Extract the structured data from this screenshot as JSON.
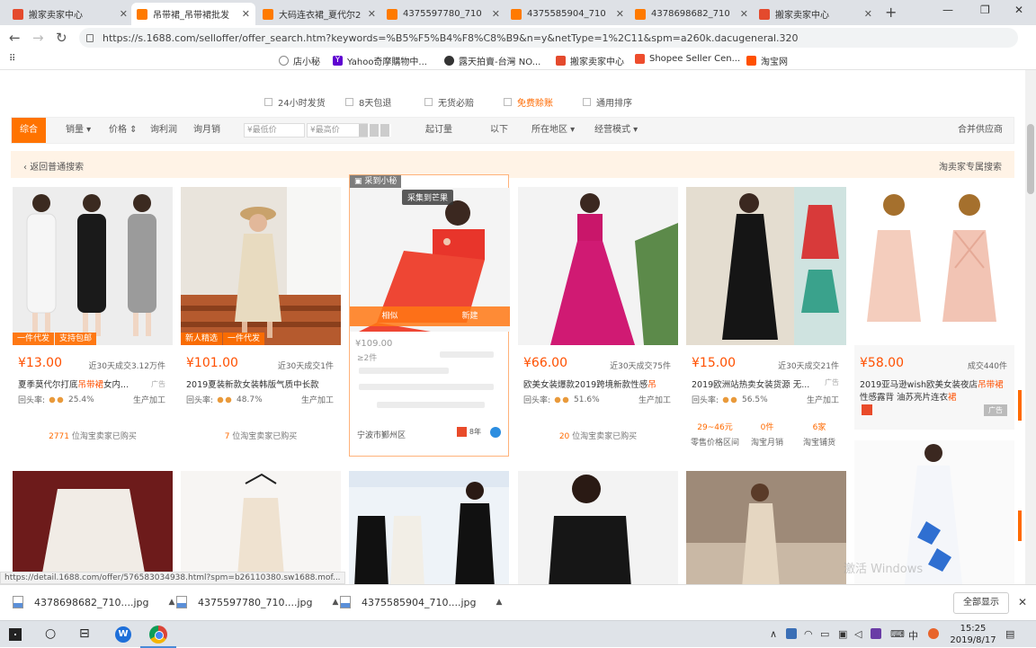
{
  "browser": {
    "tabs": [
      {
        "label": "搬家卖家中心",
        "icon": "red"
      },
      {
        "label": "吊带裙_吊带裙批发",
        "icon": "orange",
        "active": true
      },
      {
        "label": "大码连衣裙_夏代尔2",
        "icon": "orange"
      },
      {
        "label": "4375597780_710",
        "icon": "orange"
      },
      {
        "label": "4375585904_710",
        "icon": "orange"
      },
      {
        "label": "4378698682_710",
        "icon": "orange"
      },
      {
        "label": "搬家卖家中心",
        "icon": "red"
      }
    ],
    "url": "https://s.1688.com/selloffer/offer_search.htm?keywords=%B5%F5%B4%F8%C8%B9&n=y&netType=1%2C11&spm=a260k.dacugeneral.320",
    "bookmarks": [
      {
        "label": "店小秘"
      },
      {
        "label": "Yahoo奇摩購物中..."
      },
      {
        "label": "露天拍賣-台灣 NO..."
      },
      {
        "label": "搬家卖家中心"
      },
      {
        "label": "Shopee Seller Cen..."
      },
      {
        "label": "淘宝网"
      }
    ]
  },
  "filters": {
    "checks": [
      "24小时发货",
      "8天包退",
      "无货必赔",
      "免费赊账",
      "通用排序"
    ],
    "sort": {
      "active": "综合",
      "items": [
        "销量",
        "价格",
        "询利润",
        "询月销"
      ],
      "min_placeholder": "¥最低价",
      "max_placeholder": "¥最高价",
      "moq": "起订量",
      "moq_suffix": "以下",
      "region": "所在地区",
      "mode": "经营模式",
      "right": "合并供应商"
    },
    "back": "返回普通搜索",
    "back_right": "淘卖家专属搜索"
  },
  "products": [
    {
      "tags": [
        "一件代发",
        "支持包邮"
      ],
      "price": "¥13.00",
      "sold": "近30天成交3.12万件",
      "title_pre": "夏季莫代尔打底",
      "title_hl": "吊带裙",
      "title_post": "女内...",
      "ad": "广告",
      "rebuy_label": "回头率:",
      "rebuy": "25.4%",
      "mfg": "生产加工",
      "buyers_n": "2771",
      "buyers_txt": "位淘宝卖家已购买"
    },
    {
      "tags": [
        "新人精选",
        "一件代发"
      ],
      "price": "¥101.00",
      "sold": "近30天成交1件",
      "title_pre": "2019夏装新款女装韩版气质中长款",
      "title_hl": "",
      "title_post": "",
      "rebuy_label": "回头率:",
      "rebuy": "48.7%",
      "mfg": "生产加工",
      "buyers_n": "7",
      "buyers_txt": "位淘宝卖家已购买"
    },
    {
      "hover_top": "采到小秘",
      "collect": "采集到芒果",
      "actions": [
        "相似",
        "新建"
      ],
      "price": "¥109.00",
      "pieces": "≥2件",
      "supplier": "宁波市鄞州区",
      "years": "8年"
    },
    {
      "price": "¥66.00",
      "sold": "近30天成交75件",
      "title_pre": "欧美女装爆款2019跨境新款性感",
      "title_hl": "吊",
      "title_post": "",
      "rebuy_label": "回头率:",
      "rebuy": "51.6%",
      "mfg": "生产加工",
      "buyers_n": "20",
      "buyers_txt": "位淘宝卖家已购买"
    },
    {
      "price": "¥15.00",
      "sold": "近30天成交21件",
      "title_pre": "2019欧洲站热卖女装货源 无...",
      "title_hl": "",
      "title_post": "",
      "ad": "广告",
      "rebuy_label": "回头率:",
      "rebuy": "56.5%",
      "mfg": "生产加工",
      "stats": [
        {
          "v": "29~46元",
          "l": "零售价格区间"
        },
        {
          "v": "0件",
          "l": "淘宝月销"
        },
        {
          "v": "6家",
          "l": "淘宝铺货"
        }
      ]
    },
    {
      "price": "¥58.00",
      "sold": "成交440件",
      "title_pre": "2019亚马逊wish欧美女装夜店",
      "title_hl": "吊带裙",
      "title_post": "",
      "title2_pre": "性感露背 油苏亮片连衣",
      "title2_hl": "裙",
      "ad": "广告"
    }
  ],
  "status_url": "https://detail.1688.com/offer/576583034938.html?spm=b26110380.sw1688.mof...",
  "downloads": {
    "items": [
      "4378698682_710....jpg",
      "4375597780_710....jpg",
      "4375585904_710....jpg"
    ],
    "show_all": "全部显示"
  },
  "taskbar": {
    "time": "15:25",
    "date": "2019/8/17",
    "ime": "中"
  },
  "watermark": "激活 Windows"
}
